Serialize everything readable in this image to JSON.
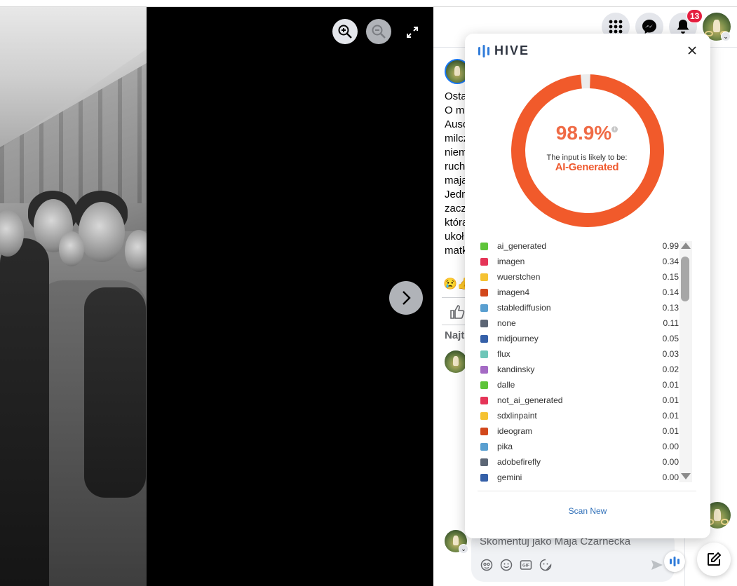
{
  "viewer": {
    "zoom_in_icon": "zoom-in-icon",
    "zoom_out_icon": "zoom-out-icon",
    "fullscreen_icon": "expand-icon",
    "next_icon": "chevron-right-icon"
  },
  "topbar": {
    "notifications_badge": "13",
    "icons": [
      "grid-menu-icon",
      "messenger-icon",
      "bell-icon"
    ]
  },
  "post": {
    "text_lines": [
      "Osta",
      "O m",
      "Ausc",
      "milcz",
      "niem",
      "ruch",
      "maja",
      "Jedn",
      "zacz",
      "która",
      "ukoł",
      "matk"
    ],
    "reactions": "😢👍",
    "comments_sort_label": "Najt"
  },
  "comment": {
    "placeholder": "Skomentuj jako Maja Czarnecka",
    "tools": [
      "avatar-sticker-icon",
      "emoji-icon",
      "gif-icon",
      "sticker-icon"
    ],
    "gif_label": "GIF"
  },
  "hive": {
    "brand": "HIVE",
    "score": "98.9%",
    "score_value": 0.989,
    "likely_label": "The input is likely to be:",
    "verdict": "AI-Generated",
    "accent": "#f15a2b",
    "scan_new": "Scan New",
    "classes": [
      {
        "name": "ai_generated",
        "value": "0.99",
        "color": "#5ec43a"
      },
      {
        "name": "imagen",
        "value": "0.34",
        "color": "#e53558"
      },
      {
        "name": "wuerstchen",
        "value": "0.15",
        "color": "#f5c232"
      },
      {
        "name": "imagen4",
        "value": "0.14",
        "color": "#d2481c"
      },
      {
        "name": "stablediffusion",
        "value": "0.13",
        "color": "#5a9fd0"
      },
      {
        "name": "none",
        "value": "0.11",
        "color": "#5c6675"
      },
      {
        "name": "midjourney",
        "value": "0.05",
        "color": "#3560a8"
      },
      {
        "name": "flux",
        "value": "0.03",
        "color": "#6ec6b8"
      },
      {
        "name": "kandinsky",
        "value": "0.02",
        "color": "#a46ac4"
      },
      {
        "name": "dalle",
        "value": "0.01",
        "color": "#5ec43a"
      },
      {
        "name": "not_ai_generated",
        "value": "0.01",
        "color": "#e53558"
      },
      {
        "name": "sdxlinpaint",
        "value": "0.01",
        "color": "#f5c232"
      },
      {
        "name": "ideogram",
        "value": "0.01",
        "color": "#d2481c"
      },
      {
        "name": "pika",
        "value": "0.00",
        "color": "#5a9fd0"
      },
      {
        "name": "adobefirefly",
        "value": "0.00",
        "color": "#5c6675"
      },
      {
        "name": "gemini",
        "value": "0.00",
        "color": "#3560a8"
      }
    ]
  }
}
